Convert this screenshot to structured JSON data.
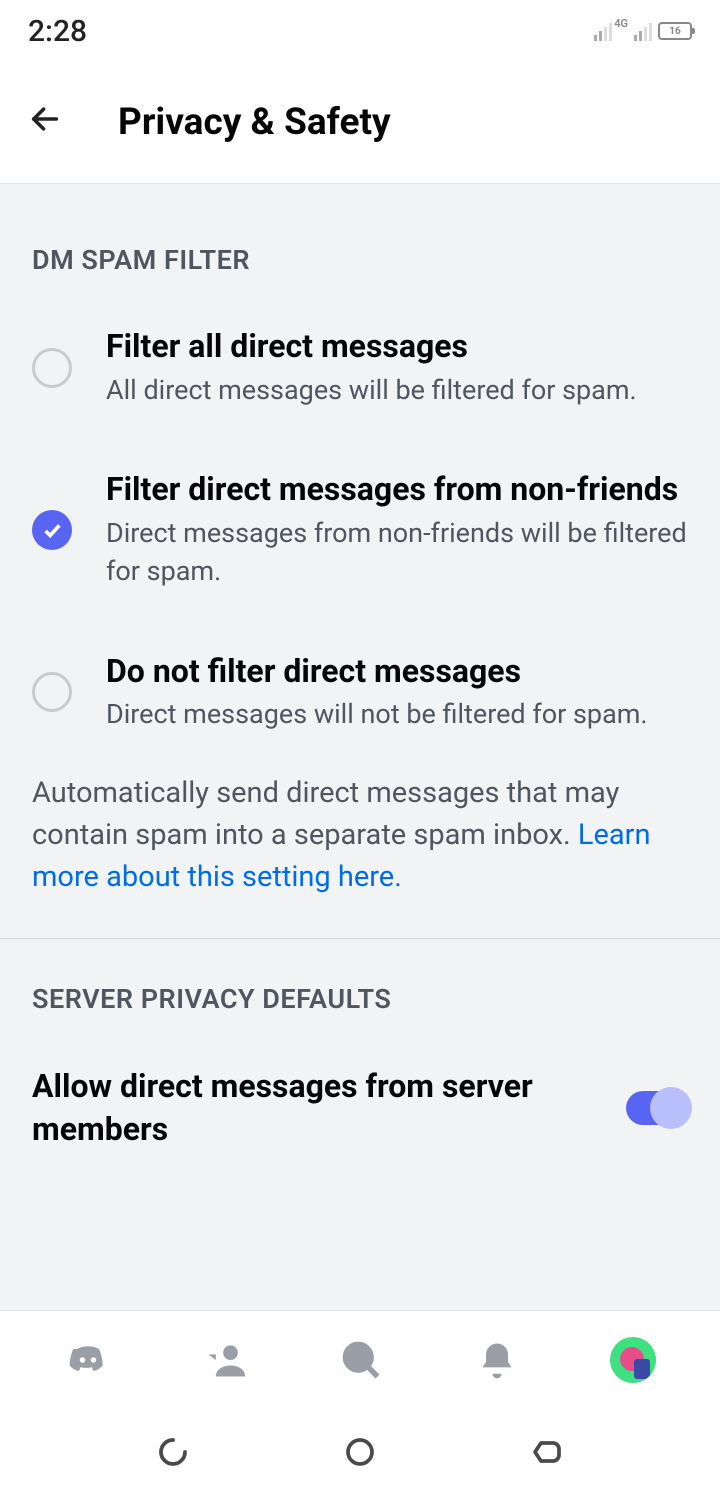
{
  "status": {
    "time": "2:28",
    "network_label": "4G",
    "battery": "16"
  },
  "header": {
    "title": "Privacy & Safety"
  },
  "dm_filter": {
    "section_header": "DM SPAM FILTER",
    "options": [
      {
        "title": "Filter all direct messages",
        "desc": "All direct messages will be filtered for spam.",
        "selected": false
      },
      {
        "title": "Filter direct messages from non-friends",
        "desc": "Direct messages from non-friends will be filtered for spam.",
        "selected": true
      },
      {
        "title": "Do not filter direct messages",
        "desc": "Direct messages will not be filtered for spam.",
        "selected": false
      }
    ],
    "footer_text": "Automatically send direct messages that may contain spam into a separate spam inbox. ",
    "footer_link": "Learn more about this setting here."
  },
  "server_privacy": {
    "section_header": "SERVER PRIVACY DEFAULTS",
    "allow_dm_label": "Allow direct messages from server members",
    "allow_dm_on": true
  }
}
